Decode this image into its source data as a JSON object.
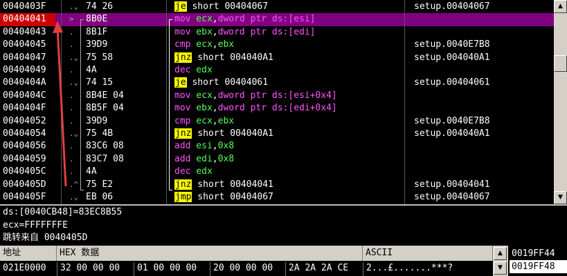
{
  "disasm": {
    "rows": [
      {
        "addr": "0040403F",
        "mark": ".⌄",
        "hex": "74 26",
        "asm": [
          {
            "t": "je",
            "c": "op-jump"
          },
          {
            "t": " short 00404067",
            "c": "plain"
          }
        ],
        "cmt": "setup.00404067"
      },
      {
        "addr": "00404041",
        "mark": ">",
        "hex": "8B0E",
        "asm": [
          {
            "t": "mov",
            "c": "op-mov"
          },
          {
            "t": " ecx",
            "c": "greg"
          },
          {
            "t": ",",
            "c": "plain"
          },
          {
            "t": "dword ptr ds:[esi]",
            "c": "mem"
          }
        ],
        "cmt": "",
        "selected": true
      },
      {
        "addr": "00404043",
        "mark": ".",
        "hex": "8B1F",
        "asm": [
          {
            "t": "mov",
            "c": "op-mov"
          },
          {
            "t": " ebx",
            "c": "greg"
          },
          {
            "t": ",",
            "c": "plain"
          },
          {
            "t": "dword ptr ds:[edi]",
            "c": "mem"
          }
        ],
        "cmt": ""
      },
      {
        "addr": "00404045",
        "mark": ".",
        "hex": "39D9",
        "asm": [
          {
            "t": "cmp",
            "c": "op-cmp"
          },
          {
            "t": " ecx",
            "c": "greg"
          },
          {
            "t": ",",
            "c": "plain"
          },
          {
            "t": "ebx",
            "c": "greg"
          }
        ],
        "cmt": "setup.0040E7B8"
      },
      {
        "addr": "00404047",
        "mark": ".⌄",
        "hex": "75 58",
        "asm": [
          {
            "t": "jnz",
            "c": "op-jump"
          },
          {
            "t": " short 004040A1",
            "c": "plain"
          }
        ],
        "cmt": "setup.004040A1"
      },
      {
        "addr": "00404049",
        "mark": ".",
        "hex": "4A",
        "asm": [
          {
            "t": "dec",
            "c": "op-arith"
          },
          {
            "t": " edx",
            "c": "greg"
          }
        ],
        "cmt": ""
      },
      {
        "addr": "0040404A",
        "mark": ".⌄",
        "hex": "74 15",
        "asm": [
          {
            "t": "je",
            "c": "op-jump"
          },
          {
            "t": " short 00404061",
            "c": "plain"
          }
        ],
        "cmt": "setup.00404061"
      },
      {
        "addr": "0040404C",
        "mark": ".",
        "hex": "8B4E 04",
        "asm": [
          {
            "t": "mov",
            "c": "op-mov"
          },
          {
            "t": " ecx",
            "c": "greg"
          },
          {
            "t": ",",
            "c": "plain"
          },
          {
            "t": "dword ptr ds:[esi+0x4]",
            "c": "mem"
          }
        ],
        "cmt": ""
      },
      {
        "addr": "0040404F",
        "mark": ".",
        "hex": "8B5F 04",
        "asm": [
          {
            "t": "mov",
            "c": "op-mov"
          },
          {
            "t": " ebx",
            "c": "greg"
          },
          {
            "t": ",",
            "c": "plain"
          },
          {
            "t": "dword ptr ds:[edi+0x4]",
            "c": "mem"
          }
        ],
        "cmt": ""
      },
      {
        "addr": "00404052",
        "mark": ".",
        "hex": "39D9",
        "asm": [
          {
            "t": "cmp",
            "c": "op-cmp"
          },
          {
            "t": " ecx",
            "c": "greg"
          },
          {
            "t": ",",
            "c": "plain"
          },
          {
            "t": "ebx",
            "c": "greg"
          }
        ],
        "cmt": "setup.0040E7B8"
      },
      {
        "addr": "00404054",
        "mark": ".⌄",
        "hex": "75 4B",
        "asm": [
          {
            "t": "jnz",
            "c": "op-jump"
          },
          {
            "t": " short 004040A1",
            "c": "plain"
          }
        ],
        "cmt": "setup.004040A1"
      },
      {
        "addr": "00404056",
        "mark": ".",
        "hex": "83C6 08",
        "asm": [
          {
            "t": "add",
            "c": "op-arith"
          },
          {
            "t": " esi",
            "c": "greg"
          },
          {
            "t": ",",
            "c": "plain"
          },
          {
            "t": "0x8",
            "c": "num"
          }
        ],
        "cmt": ""
      },
      {
        "addr": "00404059",
        "mark": ".",
        "hex": "83C7 08",
        "asm": [
          {
            "t": "add",
            "c": "op-arith"
          },
          {
            "t": " edi",
            "c": "greg"
          },
          {
            "t": ",",
            "c": "plain"
          },
          {
            "t": "0x8",
            "c": "num"
          }
        ],
        "cmt": ""
      },
      {
        "addr": "0040405C",
        "mark": ".",
        "hex": "4A",
        "asm": [
          {
            "t": "dec",
            "c": "op-arith"
          },
          {
            "t": " edx",
            "c": "greg"
          }
        ],
        "cmt": ""
      },
      {
        "addr": "0040405D",
        "mark": ".^",
        "hex": "75 E2",
        "asm": [
          {
            "t": "jnz",
            "c": "op-jump"
          },
          {
            "t": " short 00404041",
            "c": "plain"
          }
        ],
        "cmt": "setup.00404041"
      },
      {
        "addr": "0040405F",
        "mark": ".⌄",
        "hex": "EB 06",
        "asm": [
          {
            "t": "jmp",
            "c": "op-jump"
          },
          {
            "t": " short 00404067",
            "c": "plain"
          }
        ],
        "cmt": "setup.00404067"
      }
    ]
  },
  "info": {
    "line1": "ds:[0040CB48]=83EC8B55",
    "line2": "ecx=FFFFFFFE",
    "line3": "跳转来自 0040405D"
  },
  "dump": {
    "header_address": "地址",
    "header_hex": "HEX 数据",
    "header_ascii": "ASCII",
    "row_address": "021E0000",
    "row_hex_1": "32 00 00 00",
    "row_hex_2": "01 00 00 00",
    "row_hex_3": "20 00 00 00",
    "row_hex_4": "2A 2A 2A CE",
    "row_ascii": "2...£.......***?"
  },
  "stack": {
    "line1": "0019FF44",
    "line2": "0019FF48"
  },
  "colors": {
    "selected_row": "#800080",
    "selected_addr": "#cc0000",
    "jump_highlight": "#ffff00",
    "mnemonic": "#ff55ff",
    "register": "#55ff55",
    "jump_arrow": "#e04040"
  },
  "icons": {
    "scroll_up": "arrow-up-icon",
    "scroll_down": "arrow-down-icon"
  }
}
